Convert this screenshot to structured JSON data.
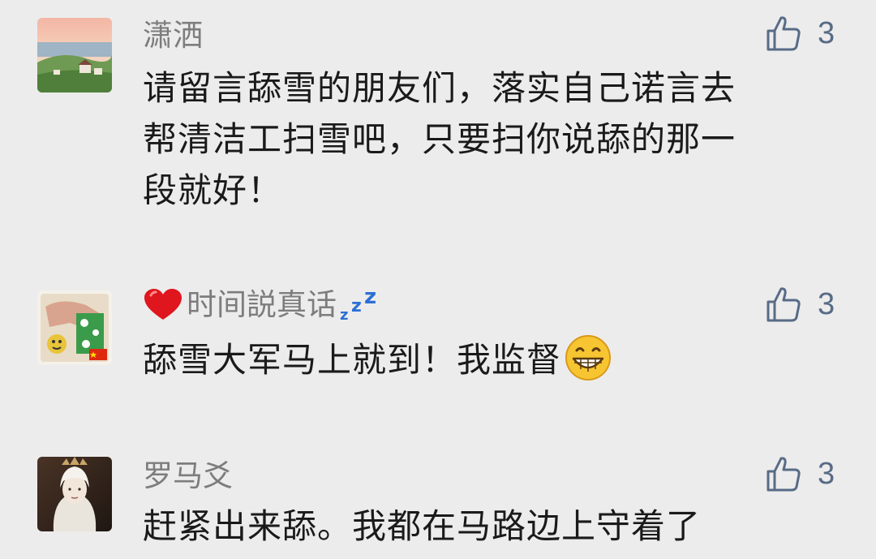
{
  "comments": [
    {
      "name": "潇洒",
      "likes": "3",
      "lines": [
        "请留言舔雪的朋友们，落实自己诺言去",
        "帮清洁工扫雪吧，只要扫你说舔的那一",
        "段就好！"
      ],
      "avatar": "landscape-photo"
    },
    {
      "name_prefix_icon": "red-heart-icon",
      "name": "时间説真话",
      "name_suffix_icon": "zzz-icon",
      "likes": "3",
      "lines": [
        "舔雪大军马上就到！我监督"
      ],
      "text_suffix_icon": "grinning-face-icon",
      "avatar": "cartoon-photo"
    },
    {
      "name": "罗马爻",
      "likes": "3",
      "lines": [
        "赶紧出来舔。我都在马路边上守着了"
      ],
      "avatar": "character-photo"
    }
  ],
  "colors": {
    "background": "#ececec",
    "name": "#7d7d7d",
    "text": "#1a1a1a",
    "like": "#586b86"
  }
}
